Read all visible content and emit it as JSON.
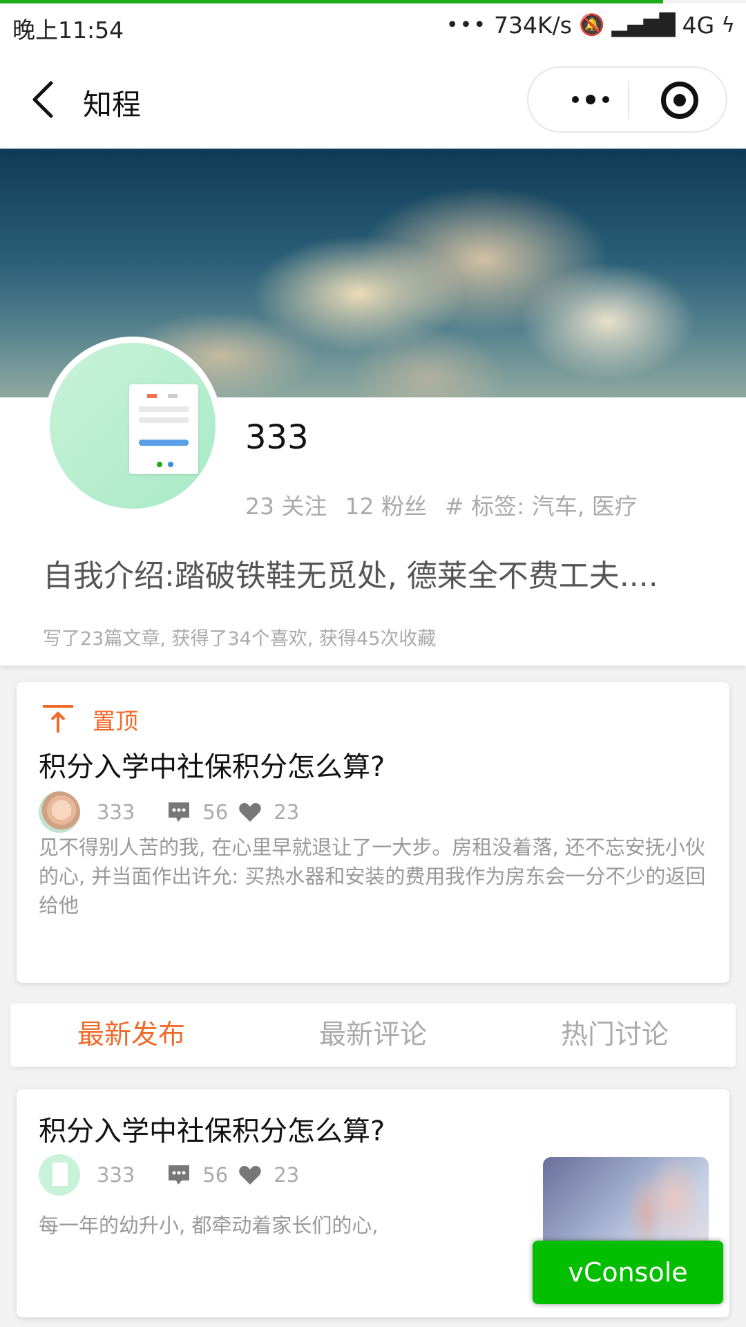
{
  "status_bar": {
    "time": "晚上11:54",
    "speed": "734K/s",
    "network": "4G"
  },
  "nav": {
    "title": "知程"
  },
  "profile": {
    "name": "333",
    "following": "23 关注",
    "followers": "12 粉丝",
    "tags_label": "# 标签: 汽车, 医疗",
    "bio": "自我介绍:踏破铁鞋无觅处, 德莱全不费工夫....",
    "summary": "写了23篇文章, 获得了34个喜欢, 获得45次收藏"
  },
  "pinned_post": {
    "pin_label": "置顶",
    "title": "积分入学中社保积分怎么算?",
    "author": "333",
    "comments": "56",
    "likes": "23",
    "body": "见不得别人苦的我, 在心里早就退让了一大步。房租没着落, 还不忘安抚小伙的心, 并当面作出许允: 买热水器和安装的费用我作为房东会一分不少的返回给他"
  },
  "tabs": [
    {
      "label": "最新发布",
      "active": true
    },
    {
      "label": "最新评论",
      "active": false
    },
    {
      "label": "热门讨论",
      "active": false
    }
  ],
  "posts": [
    {
      "title": "积分入学中社保积分怎么算?",
      "author": "333",
      "comments": "56",
      "likes": "23",
      "body": "每一年的幼升小, 都牵动着家长们的心,"
    }
  ],
  "vconsole": {
    "label": "vConsole"
  },
  "colors": {
    "accent": "#f06a2a",
    "progress": "#1aad19",
    "vconsole": "#04be02"
  }
}
